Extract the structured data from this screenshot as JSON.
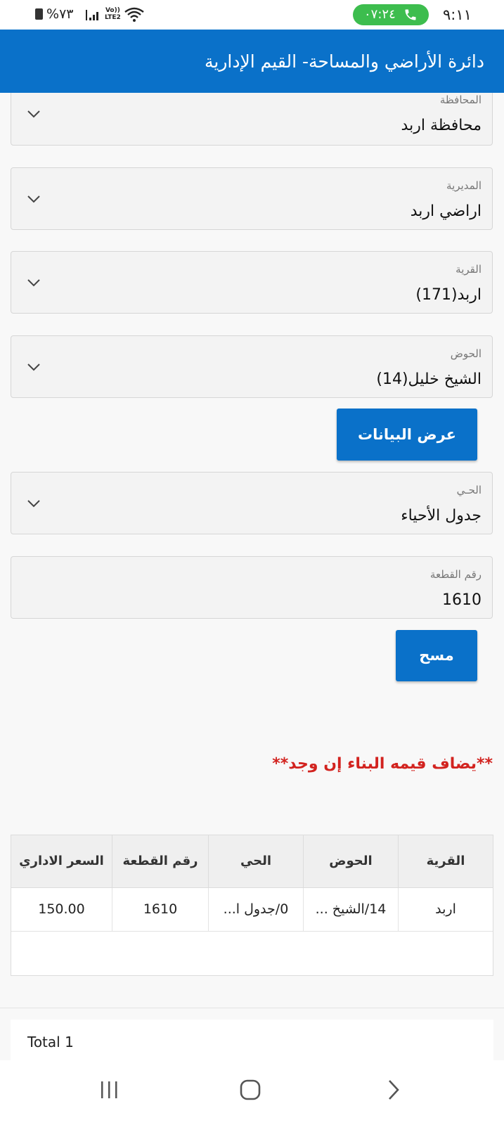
{
  "status_bar": {
    "time": "٩:١١",
    "call_time": "٠٧:٢٤",
    "battery": "%٧٣",
    "network": "Vo)) LTE2"
  },
  "app_bar": {
    "title": "دائرة الأراضي والمساحة- القيم الإدارية"
  },
  "form": {
    "governorate": {
      "label": "المحافظة",
      "value": "محافظة اربد"
    },
    "directorate": {
      "label": "المديرية",
      "value": "اراضي اربد"
    },
    "village": {
      "label": "القرية",
      "value": "اربد(171)"
    },
    "basin": {
      "label": "الحوض",
      "value": "الشيخ خليل(14)"
    },
    "show_button": "عرض البيانات",
    "district": {
      "label": "الحـي",
      "value": "جدول الأحياء"
    },
    "parcel": {
      "label": "رقم القطعة",
      "value": "1610"
    },
    "clear_button": "مسح"
  },
  "note": "**يضاف قيمه البناء إن وجد**",
  "table": {
    "headers": {
      "village": "القرية",
      "basin": "الحوض",
      "district": "الحي",
      "parcel": "رقم القطعة",
      "price": "السعر الاداري"
    },
    "rows": [
      {
        "village": "اربد",
        "basin": "14/الشيخ ...",
        "district": "0/جدول ا...",
        "parcel": "1610",
        "price": "150.00"
      }
    ]
  },
  "total": "Total 1",
  "colors": {
    "primary": "#0a71c9",
    "note": "#d2231f",
    "call_pill": "#3dbd4e"
  }
}
